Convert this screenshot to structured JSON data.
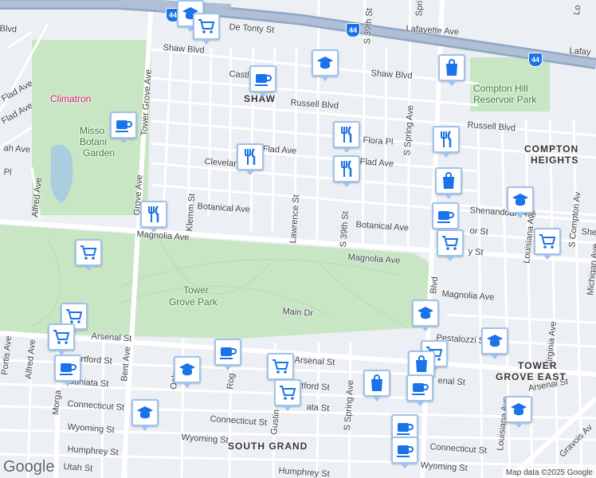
{
  "map": {
    "streets": [
      {
        "text": "De Tonty St",
        "slug": "de-tonty-st"
      },
      {
        "text": "Lafayette Ave",
        "slug": "lafayette-ave"
      },
      {
        "text": "Lafay",
        "slug": "lafay"
      },
      {
        "text": "Shaw Blvd",
        "slug": "shaw-blvd-west"
      },
      {
        "text": "Castle",
        "slug": "castleman-ave"
      },
      {
        "text": "Shaw Blvd",
        "slug": "shaw-blvd-east"
      },
      {
        "text": "Russell Blvd",
        "slug": "russell-blvd-west"
      },
      {
        "text": "Russell Blvd",
        "slug": "russell-blvd-east"
      },
      {
        "text": "Flad Ave",
        "slug": "flad-ave-west"
      },
      {
        "text": "Flad Ave",
        "slug": "flad-ave-mid"
      },
      {
        "text": "Flad Ave",
        "slug": "flad-ave-east"
      },
      {
        "text": "Flora Pl",
        "slug": "flora-pl"
      },
      {
        "text": "Clevelan",
        "slug": "cleveland-ave"
      },
      {
        "text": "Pl",
        "slug": "pl-west"
      },
      {
        "text": "ah Ave",
        "slug": "ah-ave"
      },
      {
        "text": "Botanical Ave",
        "slug": "botanical-ave-west"
      },
      {
        "text": "Botanical Ave",
        "slug": "botanical-ave-east"
      },
      {
        "text": "Shenandoah Ave",
        "slug": "shenandoah-ave"
      },
      {
        "text": "or St",
        "slug": "or-st"
      },
      {
        "text": "y St",
        "slug": "y-st"
      },
      {
        "text": "She",
        "slug": "she"
      },
      {
        "text": "Magnolia Ave",
        "slug": "magnolia-ave-west"
      },
      {
        "text": "Magnolia Ave",
        "slug": "magnolia-ave-mid"
      },
      {
        "text": "Magnolia Ave",
        "slug": "magnolia-ave-east"
      },
      {
        "text": "Main Dr",
        "slug": "main-dr"
      },
      {
        "text": "Arsenal St",
        "slug": "arsenal-st-west"
      },
      {
        "text": "Arsenal St",
        "slug": "arsenal-st-mid"
      },
      {
        "text": "enal St",
        "slug": "enal-st"
      },
      {
        "text": "Arsenal St",
        "slug": "arsenal-st-east"
      },
      {
        "text": "Pestalozzi St",
        "slug": "pestalozzi-st"
      },
      {
        "text": "Hartford St",
        "slug": "hartford-st-west"
      },
      {
        "text": "rtford St",
        "slug": "rtford-st"
      },
      {
        "text": "Juniata St",
        "slug": "juniata-st"
      },
      {
        "text": "ata St",
        "slug": "ata-st"
      },
      {
        "text": "Connecticut St",
        "slug": "connecticut-st-west"
      },
      {
        "text": "Connecticut St",
        "slug": "connecticut-st-mid"
      },
      {
        "text": "Connecticut St",
        "slug": "connecticut-st-east"
      },
      {
        "text": "Wyoming St",
        "slug": "wyoming-st-west"
      },
      {
        "text": "Wyoming St",
        "slug": "wyoming-st-mid"
      },
      {
        "text": "Wyoming St",
        "slug": "wyoming-st-east"
      },
      {
        "text": "Humphrey St",
        "slug": "humphrey-st-west"
      },
      {
        "text": "Humphrey St",
        "slug": "humphrey-st-east"
      },
      {
        "text": "Utah St",
        "slug": "utah-st"
      },
      {
        "text": "Tower Grove Ave",
        "slug": "tower-grove-ave"
      },
      {
        "text": "Grove Ave",
        "slug": "grove-ave"
      },
      {
        "text": "Klemm St",
        "slug": "klemm-st"
      },
      {
        "text": "Lawrence St",
        "slug": "lawrence-st"
      },
      {
        "text": "S 39th St",
        "slug": "s-39th-st-north"
      },
      {
        "text": "S 39th St",
        "slug": "s-39th-st-mid"
      },
      {
        "text": "S Spring Ave",
        "slug": "s-spring-ave-north"
      },
      {
        "text": "S Spring Ave",
        "slug": "s-spring-ave-south"
      },
      {
        "text": "Louisiana Ave",
        "slug": "louisiana-ave-north"
      },
      {
        "text": "Louisiana Ave",
        "slug": "louisiana-ave-south"
      },
      {
        "text": "S Compton Av",
        "slug": "s-compton-av"
      },
      {
        "text": "Virginia Ave",
        "slug": "virginia-ave"
      },
      {
        "text": "Michigan Ave",
        "slug": "michigan-ave"
      },
      {
        "text": "Alfred Ave",
        "slug": "alfred-ave-north"
      },
      {
        "text": "Alfred Ave",
        "slug": "alfred-ave-south"
      },
      {
        "text": "Flad Ave",
        "slug": "flad-ave-far-west"
      },
      {
        "text": "Portis Ave",
        "slug": "portis-ave"
      },
      {
        "text": "Bent Ave",
        "slug": "bent-ave"
      },
      {
        "text": "Oak",
        "slug": "oak"
      },
      {
        "text": "Rog",
        "slug": "rog"
      },
      {
        "text": "Gustin",
        "slug": "gustine"
      },
      {
        "text": "Morga",
        "slug": "morgan"
      },
      {
        "text": "Blvd",
        "slug": "grand-blvd"
      },
      {
        "text": "Gravois Av",
        "slug": "gravois-av"
      },
      {
        "text": "Blvd",
        "slug": "blvd-top-left"
      },
      {
        "text": "Spri",
        "slug": "spring-top"
      },
      {
        "text": "Lo",
        "slug": "lo-top"
      }
    ],
    "places": [
      {
        "text": "Climatron",
        "slug": "climatron",
        "kind": "poi"
      },
      {
        "text": "Misso",
        "slug": "missouri",
        "kind": "park"
      },
      {
        "text": "Botani",
        "slug": "botanical",
        "kind": "park"
      },
      {
        "text": "Garden",
        "slug": "garden",
        "kind": "park"
      },
      {
        "text": "Tower",
        "slug": "tower",
        "kind": "park"
      },
      {
        "text": "Grove Park",
        "slug": "grove-park",
        "kind": "park"
      },
      {
        "text": "Compton Hill",
        "slug": "compton-hill",
        "kind": "park"
      },
      {
        "text": "Reservoir Park",
        "slug": "reservoir-park",
        "kind": "park"
      },
      {
        "text": "SHAW",
        "slug": "shaw",
        "kind": "hood"
      },
      {
        "text": "COMPTON",
        "slug": "compton",
        "kind": "hood"
      },
      {
        "text": "HEIGHTS",
        "slug": "heights",
        "kind": "hood"
      },
      {
        "text": "TOWER",
        "slug": "tower-east-1",
        "kind": "hood"
      },
      {
        "text": "GROVE EAST",
        "slug": "tower-east-2",
        "kind": "hood"
      },
      {
        "text": "SOUTH GRAND",
        "slug": "south-grand",
        "kind": "hood"
      }
    ],
    "shields": [
      {
        "text": "44",
        "slug": "i44-west"
      },
      {
        "text": "44",
        "slug": "i44-mid"
      },
      {
        "text": "44",
        "slug": "i44-east"
      }
    ],
    "markers": [
      {
        "icon": "school",
        "slug": "school-top"
      },
      {
        "icon": "cart",
        "slug": "cart-top"
      },
      {
        "icon": "cafe",
        "slug": "cafe-shaw"
      },
      {
        "icon": "school",
        "slug": "school-shaw"
      },
      {
        "icon": "bag",
        "slug": "bag-top"
      },
      {
        "icon": "cafe",
        "slug": "cafe-garden"
      },
      {
        "icon": "restaurant",
        "slug": "restaurant-flad"
      },
      {
        "icon": "restaurant",
        "slug": "restaurant-39th-1"
      },
      {
        "icon": "restaurant",
        "slug": "restaurant-39th-2"
      },
      {
        "icon": "restaurant",
        "slug": "restaurant-russell"
      },
      {
        "icon": "bag",
        "slug": "bag-grand"
      },
      {
        "icon": "school",
        "slug": "school-shenandoah"
      },
      {
        "icon": "cafe",
        "slug": "cafe-grand"
      },
      {
        "icon": "cart",
        "slug": "cart-grand"
      },
      {
        "icon": "cart",
        "slug": "cart-louisiana"
      },
      {
        "icon": "restaurant",
        "slug": "restaurant-tower"
      },
      {
        "icon": "cart",
        "slug": "cart-park-west"
      },
      {
        "icon": "cart",
        "slug": "cart-arsenal-1"
      },
      {
        "icon": "cart",
        "slug": "cart-arsenal-2"
      },
      {
        "icon": "cafe",
        "slug": "cafe-morgan"
      },
      {
        "icon": "cafe",
        "slug": "cafe-arsenal"
      },
      {
        "icon": "school",
        "slug": "school-oak"
      },
      {
        "icon": "cart",
        "slug": "cart-hartford"
      },
      {
        "icon": "cart",
        "slug": "cart-juniata"
      },
      {
        "icon": "school",
        "slug": "school-connecticut"
      },
      {
        "icon": "bag",
        "slug": "bag-spring"
      },
      {
        "icon": "school",
        "slug": "school-magnolia"
      },
      {
        "icon": "school",
        "slug": "school-pestalozzi"
      },
      {
        "icon": "cart",
        "slug": "cart-grand-south"
      },
      {
        "icon": "bag",
        "slug": "bag-grand-south"
      },
      {
        "icon": "cafe",
        "slug": "cafe-grand-south"
      },
      {
        "icon": "school",
        "slug": "school-arsenal-east"
      },
      {
        "icon": "cafe",
        "slug": "cafe-wyoming-1"
      },
      {
        "icon": "cafe",
        "slug": "cafe-wyoming-2"
      }
    ],
    "branding": "Google",
    "attribution": "Map data ©2025 Google"
  }
}
